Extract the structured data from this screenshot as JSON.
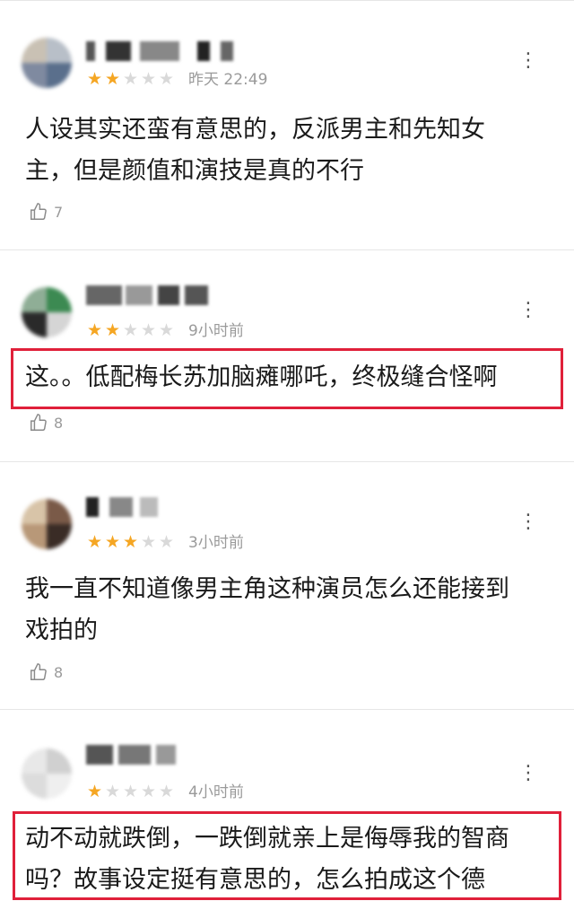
{
  "reviews": [
    {
      "rating": 2,
      "time": "昨天 22:49",
      "content_lines": [
        "人设其实还蛮有意思的，反派男主和先知女",
        "主，但是颜值和演技是真的不行"
      ],
      "likes": "7",
      "highlighted": false
    },
    {
      "rating": 2,
      "time": "9小时前",
      "content_lines": [
        "这。。低配梅长苏加脑瘫哪吒，终极缝合怪啊"
      ],
      "likes": "8",
      "highlighted": true
    },
    {
      "rating": 3,
      "time": "3小时前",
      "content_lines": [
        "我一直不知道像男主角这种演员怎么还能接到",
        "戏拍的"
      ],
      "likes": "8",
      "highlighted": false
    },
    {
      "rating": 1,
      "time": "4小时前",
      "content_lines": [
        "动不动就跌倒，一跌倒就亲上是侮辱我的智商",
        "吗？故事设定挺有意思的，怎么拍成这个德"
      ],
      "likes": "",
      "highlighted": true
    }
  ],
  "more_icon": "more-dots-icon",
  "like_icon": "thumbs-up-icon",
  "star_icon": "star-icon",
  "colors": {
    "star_on": "#f5a623",
    "star_off": "#d9d9d9",
    "highlight_border": "#e0203a"
  }
}
